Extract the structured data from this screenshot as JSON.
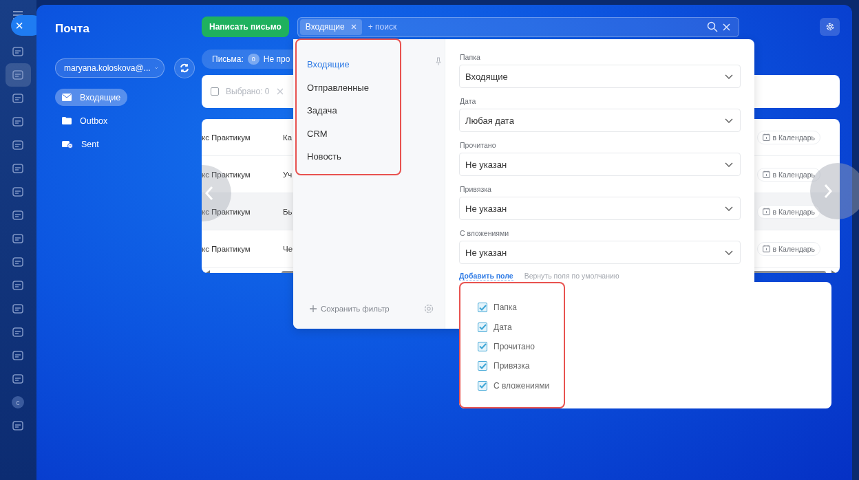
{
  "background_nav": {
    "items": [
      {
        "active": false
      },
      {
        "active": true
      },
      {
        "active": false
      },
      {
        "active": false
      },
      {
        "active": false
      },
      {
        "active": false
      },
      {
        "active": false
      },
      {
        "active": false
      },
      {
        "active": false
      },
      {
        "active": false
      },
      {
        "active": false
      },
      {
        "active": false
      },
      {
        "active": false
      },
      {
        "active": false
      },
      {
        "active": false
      },
      {
        "active": false
      },
      {
        "active": false
      }
    ],
    "avatar_letter": "с"
  },
  "close_button": "×",
  "mail": {
    "title": "Почта",
    "account": "maryana.koloskova@...",
    "folders": [
      {
        "label": "Входящие",
        "selected": true
      },
      {
        "label": "Outbox",
        "selected": false
      },
      {
        "label": "Sent",
        "selected": false
      }
    ]
  },
  "toolbar": {
    "compose": "Написать письмо",
    "search": {
      "tag": "Входящие",
      "placeholder": "+ поиск"
    }
  },
  "counters": {
    "label": "Письма:",
    "count": "0",
    "next": "Не про"
  },
  "selection": {
    "checked": false,
    "text": "Выбрано: 0"
  },
  "table": {
    "rows": [
      {
        "sender": "кс Практикум",
        "subject": "Ка",
        "action": "в Календарь",
        "highlighted": false
      },
      {
        "sender": "кс Практикум",
        "subject": "Уч",
        "action": "в Календарь",
        "highlighted": false
      },
      {
        "sender": "кс Практикум",
        "subject": "Бь",
        "action": "в Календарь",
        "highlighted": true
      },
      {
        "sender": "кс Практикум",
        "subject": "Че",
        "action": "в Календарь",
        "highlighted": false
      }
    ]
  },
  "filter": {
    "presets": [
      {
        "label": "Входящие",
        "selected": true
      },
      {
        "label": "Отправленные",
        "selected": false
      },
      {
        "label": "Задача",
        "selected": false
      },
      {
        "label": "CRM",
        "selected": false
      },
      {
        "label": "Новость",
        "selected": false
      }
    ],
    "save_filter": "Сохранить фильтр",
    "fields": [
      {
        "label": "Папка",
        "value": "Входящие"
      },
      {
        "label": "Дата",
        "value": "Любая дата"
      },
      {
        "label": "Прочитано",
        "value": "Не указан"
      },
      {
        "label": "Привязка",
        "value": "Не указан"
      },
      {
        "label": "С вложениями",
        "value": "Не указан"
      }
    ],
    "add_field": "Добавить поле",
    "reset_fields": "Вернуть поля по умолчанию",
    "field_options": [
      {
        "label": "Папка",
        "checked": true
      },
      {
        "label": "Дата",
        "checked": true
      },
      {
        "label": "Прочитано",
        "checked": true
      },
      {
        "label": "Привязка",
        "checked": true
      },
      {
        "label": "С вложениями",
        "checked": true
      }
    ]
  }
}
